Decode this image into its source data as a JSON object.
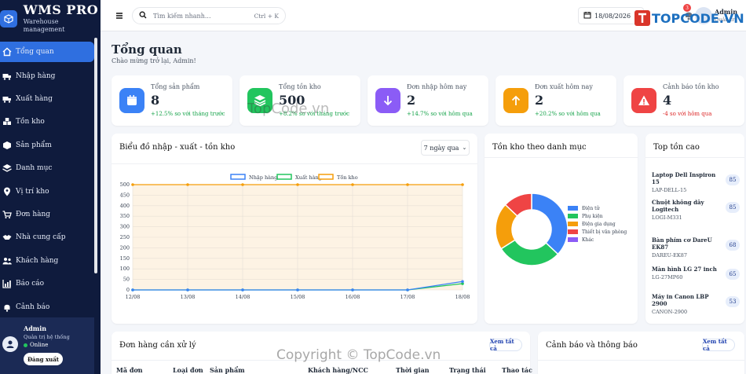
{
  "brand": {
    "name": "WMS PRO",
    "subtitle": "Warehouse management"
  },
  "nav": [
    {
      "label": "Tổng quan",
      "icon": "home-icon",
      "active": true
    },
    {
      "label": "Nhập hàng",
      "icon": "truck-in-icon"
    },
    {
      "label": "Xuất hàng",
      "icon": "truck-out-icon"
    },
    {
      "label": "Tồn kho",
      "icon": "boxes-icon"
    },
    {
      "label": "Sản phẩm",
      "icon": "box-icon"
    },
    {
      "label": "Danh mục",
      "icon": "layers-icon"
    },
    {
      "label": "Vị trí kho",
      "icon": "location-icon"
    },
    {
      "label": "Đơn hàng",
      "icon": "cart-icon"
    },
    {
      "label": "Nhà cung cấp",
      "icon": "handshake-icon"
    },
    {
      "label": "Khách hàng",
      "icon": "users-icon"
    },
    {
      "label": "Báo cáo",
      "icon": "report-icon"
    },
    {
      "label": "Cảnh báo",
      "icon": "bell-icon"
    }
  ],
  "user": {
    "name": "Admin",
    "role": "Quản trị hệ thống",
    "status": "Online",
    "logout": "Đăng xuất"
  },
  "topbar": {
    "search_placeholder": "Tìm kiếm nhanh...",
    "shortcut": "Ctrl + K",
    "date": "18/08/2026",
    "notif_count": "3",
    "admin_name": "Admin",
    "admin_role": "Quản trị"
  },
  "page": {
    "title": "Tổng quan",
    "subtitle": "Chào mừng trở lại, Admin!"
  },
  "stats": [
    {
      "label": "Tổng sản phẩm",
      "value": "8",
      "delta": "+12.5% so với tháng trước",
      "trend": "up",
      "color": "#3b82f6",
      "icon": "calendar-box-icon"
    },
    {
      "label": "Tổng tồn kho",
      "value": "500",
      "delta": "+8.2% so với tháng trước",
      "trend": "up",
      "color": "#22c55e",
      "icon": "stack-icon"
    },
    {
      "label": "Đơn nhập hôm nay",
      "value": "2",
      "delta": "+14.7% so với hôm qua",
      "trend": "up",
      "color": "#8b5cf6",
      "icon": "arrow-down-icon"
    },
    {
      "label": "Đơn xuất hôm nay",
      "value": "2",
      "delta": "+20.2% so với hôm qua",
      "trend": "up",
      "color": "#f59e0b",
      "icon": "arrow-up-icon"
    },
    {
      "label": "Cảnh báo tồn kho",
      "value": "4",
      "delta": "-4 so với hôm qua",
      "trend": "down",
      "color": "#ef4444",
      "icon": "warning-icon"
    }
  ],
  "line_card": {
    "title": "Biểu đồ nhập - xuất - tồn kho",
    "range": "7 ngày qua"
  },
  "donut_card": {
    "title": "Tồn kho theo danh mục"
  },
  "top_card": {
    "title": "Top tồn cao",
    "items": [
      {
        "name": "Laptop Dell Inspiron 15",
        "code": "LAP-DELL-15",
        "qty": "85"
      },
      {
        "name": "Chuột không dây Logitech",
        "code": "LOGI-M331",
        "qty": "85"
      },
      {
        "name": "Bàn phím cơ DareU EK87",
        "code": "DAREU-EK87",
        "qty": "68"
      },
      {
        "name": "Màn hình LG 27 inch",
        "code": "LG-27MP60",
        "qty": "65"
      },
      {
        "name": "Máy in Canon LBP 2900",
        "code": "CANON-2900",
        "qty": "53"
      }
    ]
  },
  "orders_card": {
    "title": "Đơn hàng cần xử lý",
    "link": "Xem tất cả",
    "columns": [
      "Mã đơn",
      "Loại đơn",
      "Sản phẩm",
      "Khách hàng/NCC",
      "Thời gian",
      "Trạng thái",
      "Thao tác"
    ]
  },
  "alerts_card": {
    "title": "Cảnh báo và thông báo",
    "link": "Xem tất cả"
  },
  "watermark": {
    "center": "TopCode.vn",
    "bottom": "Copyright © TopCode.vn",
    "logo": "TOPCODE.VN"
  },
  "chart_data": [
    {
      "type": "line",
      "categories": [
        "12/08",
        "13/08",
        "14/08",
        "15/08",
        "16/08",
        "17/08",
        "18/08"
      ],
      "series": [
        {
          "name": "Nhập hàng",
          "color": "#3b82f6",
          "values": [
            0,
            0,
            0,
            0,
            0,
            0,
            40
          ]
        },
        {
          "name": "Xuất hàng",
          "color": "#22c55e",
          "values": [
            0,
            0,
            0,
            0,
            0,
            0,
            30
          ]
        },
        {
          "name": "Tồn kho",
          "color": "#f59e0b",
          "values": [
            500,
            500,
            500,
            500,
            500,
            500,
            500
          ]
        }
      ],
      "yticks": [
        0,
        50,
        100,
        150,
        200,
        250,
        300,
        350,
        400,
        450,
        500
      ],
      "ylim": [
        0,
        500
      ]
    },
    {
      "type": "pie",
      "labels": [
        "Điện tử",
        "Phụ kiện",
        "Điện gia dụng",
        "Thiết bị văn phòng",
        "Khác"
      ],
      "values": [
        37,
        29,
        21,
        13,
        0
      ],
      "colors": [
        "#3b82f6",
        "#22c55e",
        "#f59e0b",
        "#ef4444",
        "#8b5cf6"
      ]
    }
  ]
}
